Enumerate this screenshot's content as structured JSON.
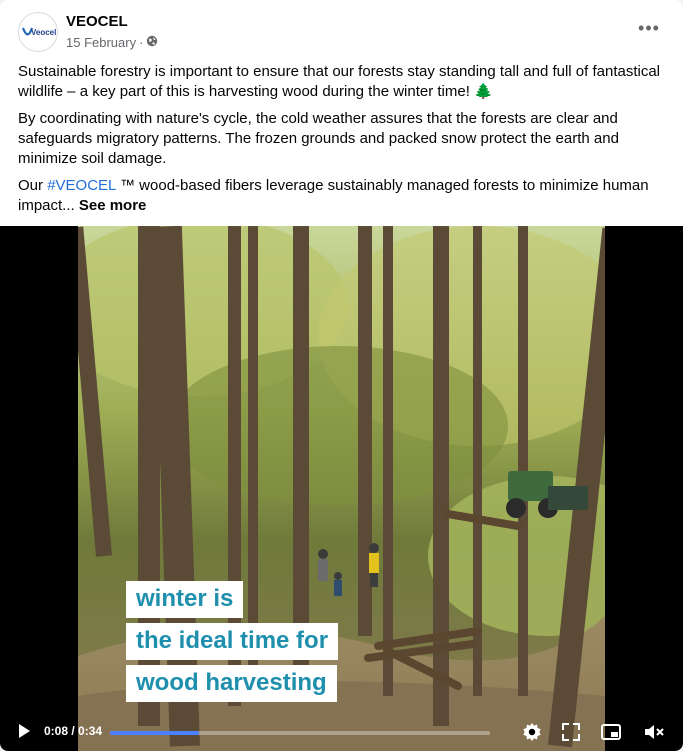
{
  "post": {
    "author": "VEOCEL",
    "avatar_text": "Veocel",
    "date": "15 February",
    "date_separator": "·",
    "more_label": "•••"
  },
  "text": {
    "p1": "Sustainable forestry is important to ensure that our forests stay standing tall and full of fantastical wildlife – a key part of this is harvesting wood during the winter time! 🌲",
    "p2": "By coordinating with nature's cycle, the cold weather assures that the forests are clear and safeguards migratory patterns. The frozen grounds and packed snow protect the earth and minimize soil damage.",
    "p3_prefix": "Our ",
    "hashtag": "#VEOCEL",
    "p3_rest": " ™ wood-based fibers leverage sustainably managed forests to minimize human impact... ",
    "see_more": "See more"
  },
  "video": {
    "overlay_lines": [
      "winter is",
      "the ideal time for",
      "wood harvesting"
    ],
    "current_time": "0:08",
    "duration": "0:34",
    "time_separator": " / ",
    "progress_fraction": 0.235,
    "icons": [
      "play-icon",
      "settings-gear-icon",
      "fullscreen-icon",
      "picture-in-picture-icon",
      "muted-speaker-icon"
    ]
  },
  "colors": {
    "link": "#216fdb",
    "overlay_text": "#1f8fae",
    "progress": "#4a7fff"
  }
}
